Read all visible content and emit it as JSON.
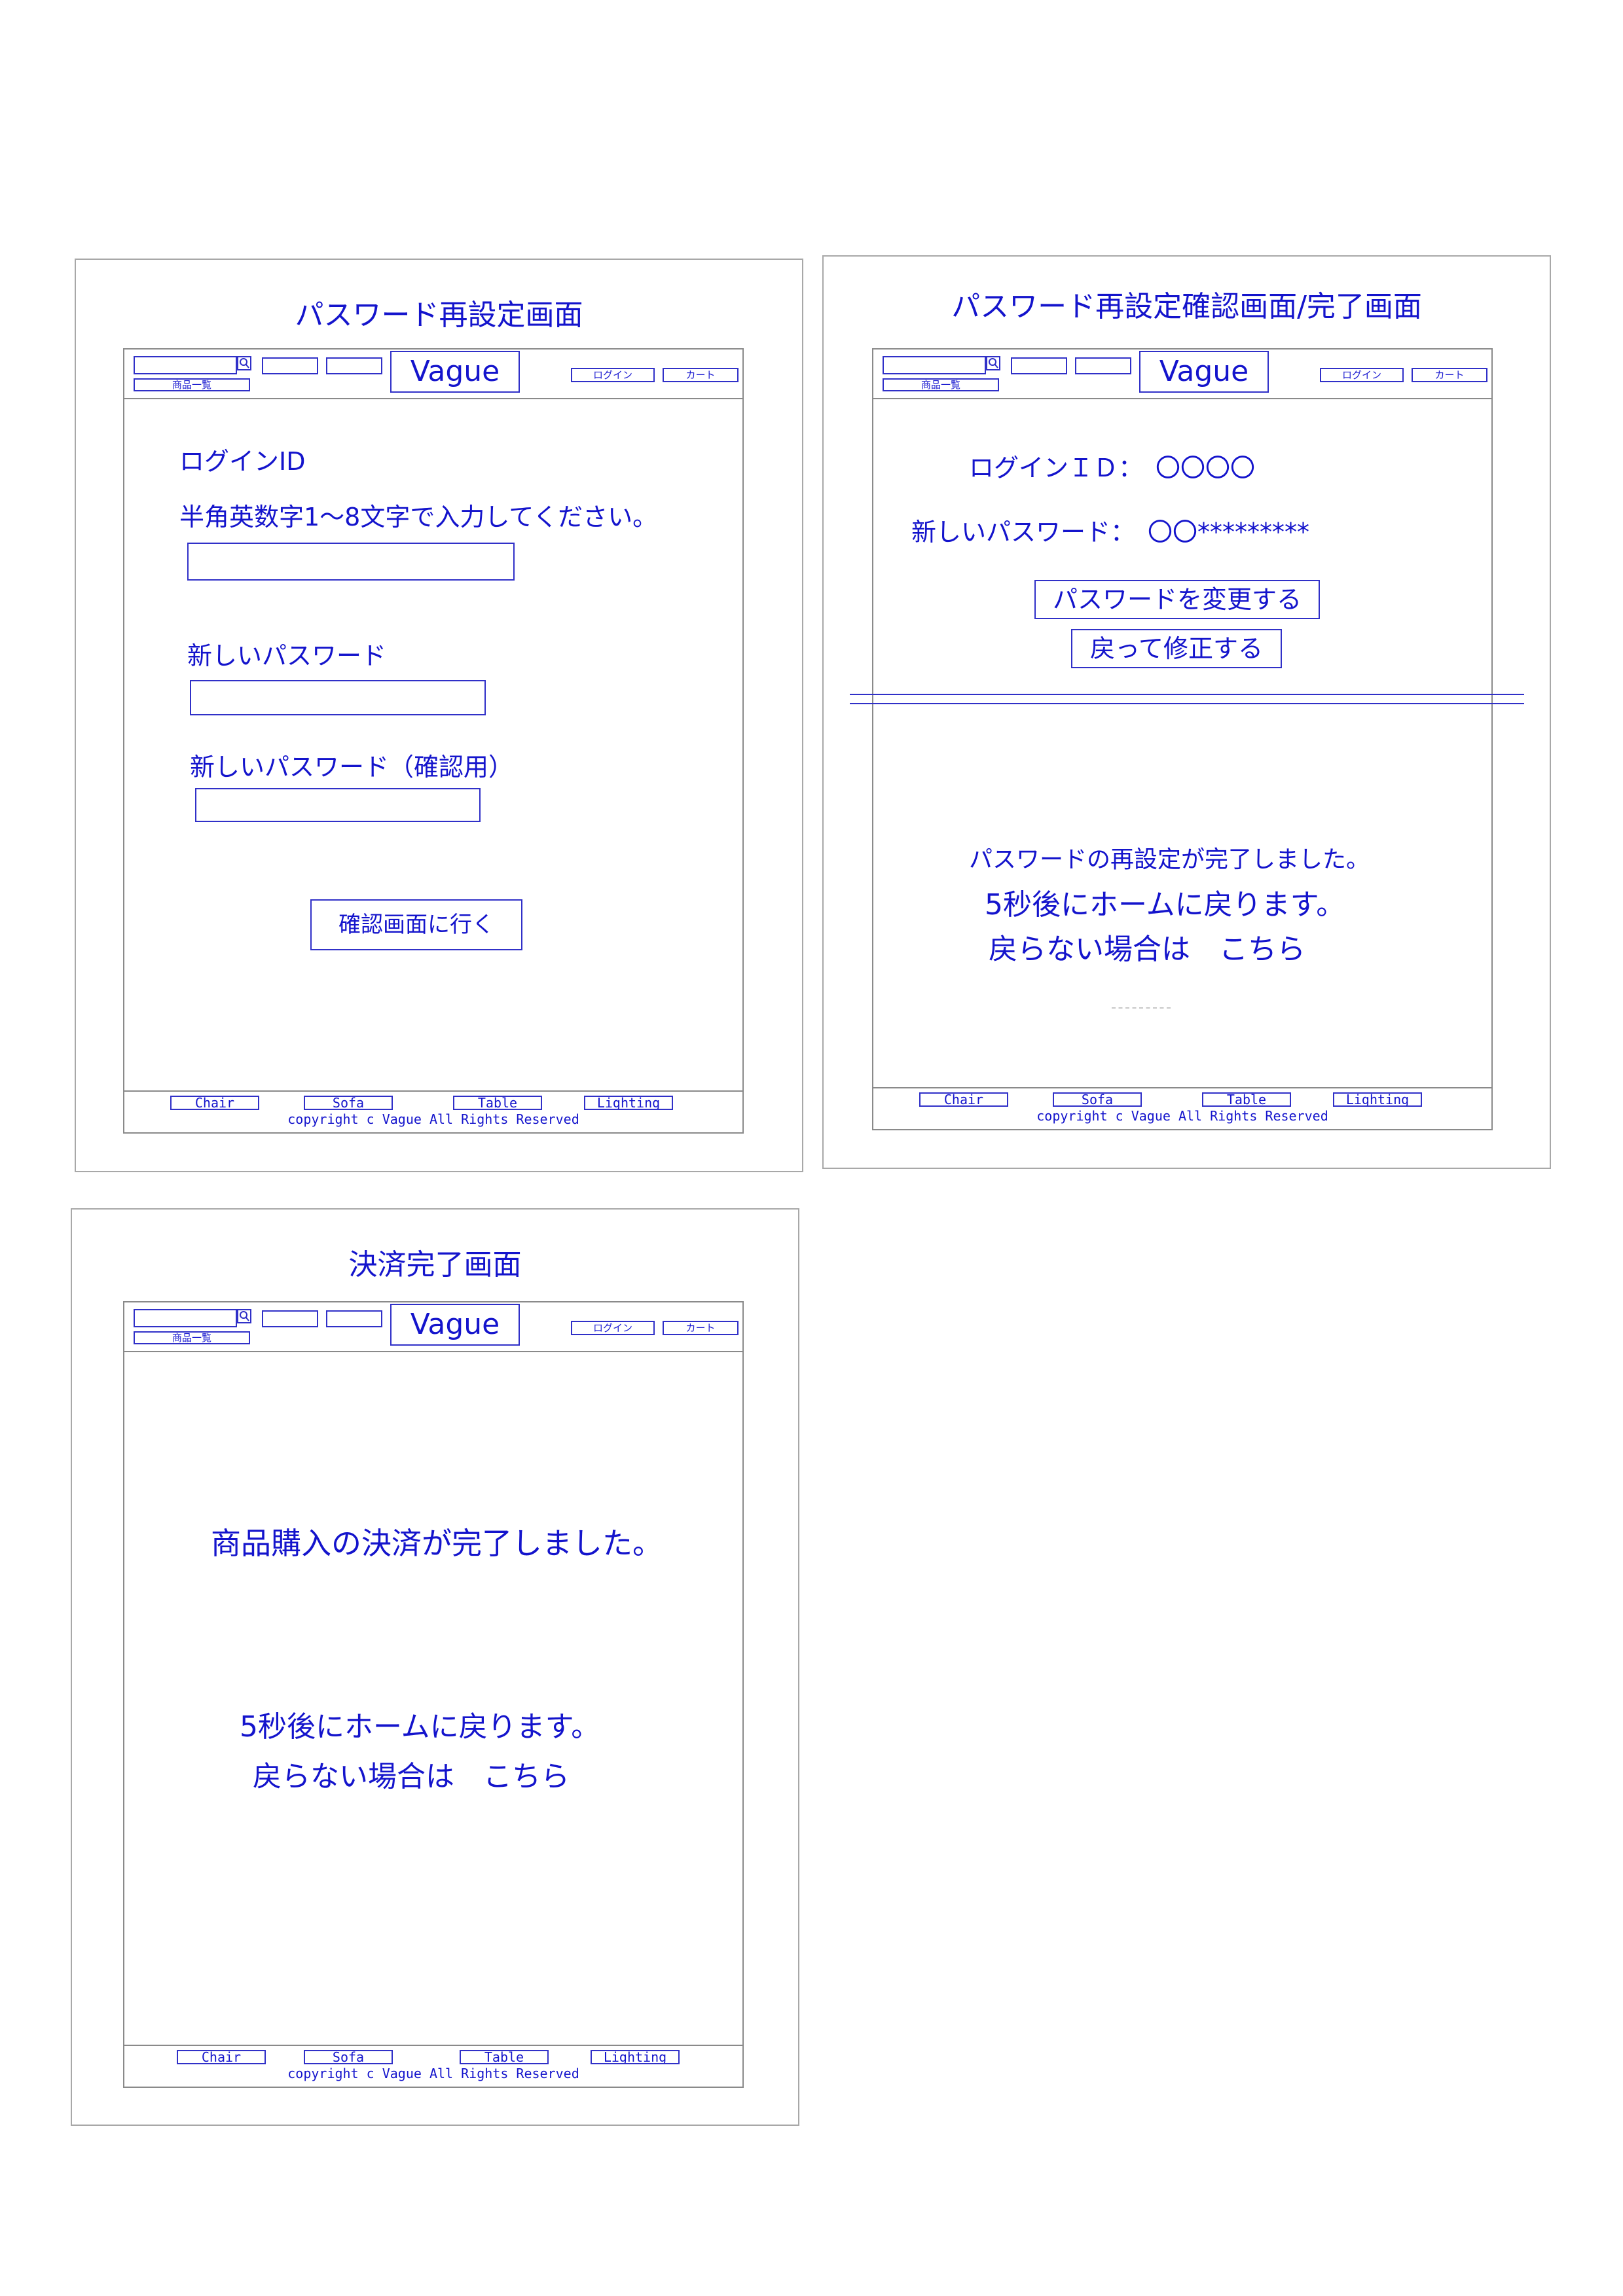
{
  "common": {
    "logo": "Vague",
    "catalog_label": "商品一覧",
    "login_label": "ログイン",
    "cart_label": "カート",
    "footer_links": [
      "Chair",
      "Sofa",
      "Table",
      "Lighting"
    ],
    "copyright": "copyright c Vague All Rights Reserved"
  },
  "panel1": {
    "title": "パスワード再設定画面",
    "login_id_label": "ログインID",
    "login_id_hint": "半角英数字1～8文字で入力してください。",
    "new_password_label": "新しいパスワード",
    "confirm_password_label": "新しいパスワード（確認用）",
    "confirm_button": "確認画面に行く"
  },
  "panel2": {
    "title": "パスワード再設定確認画面/完了画面",
    "login_id_row": "ログインＩＤ：　〇〇〇〇",
    "new_password_row": "新しいパスワード：　〇〇*********",
    "change_button": "パスワードを変更する",
    "back_button": "戻って修正する",
    "done_message": "パスワードの再設定が完了しました。",
    "redirect_message": "5秒後にホームに戻ります。",
    "fallback_message": "戻らない場合は　こちら"
  },
  "panel3": {
    "title": "決済完了画面",
    "done_message": "商品購入の決済が完了しました。",
    "redirect_message": "5秒後にホームに戻ります。",
    "fallback_message": "戻らない場合は　こちら"
  }
}
